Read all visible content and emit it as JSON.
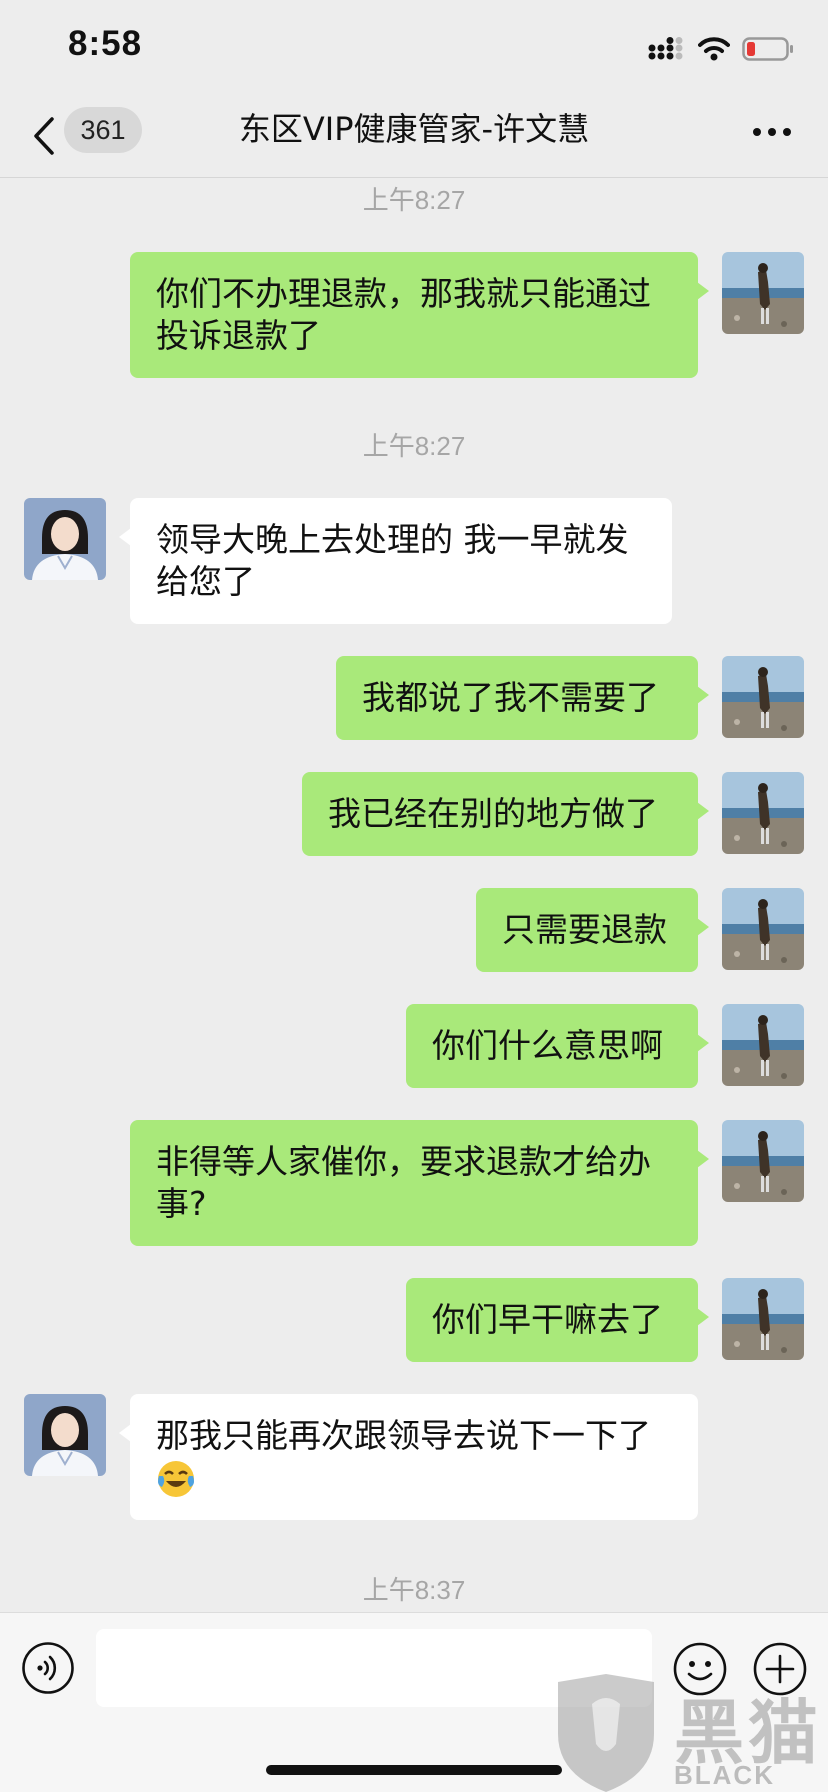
{
  "status_bar": {
    "time": "8:58"
  },
  "nav": {
    "unread_count": "361",
    "title": "东区VIP健康管家-许文慧"
  },
  "messages": [
    {
      "type": "time",
      "text": "上午8:27"
    },
    {
      "type": "outgoing",
      "text": "你们不办理退款，那我就只能通过投诉退款了"
    },
    {
      "type": "time",
      "text": "上午8:27"
    },
    {
      "type": "incoming",
      "text": "领导大晚上去处理的 我一早就发给您了"
    },
    {
      "type": "outgoing",
      "text": "我都说了我不需要了"
    },
    {
      "type": "outgoing",
      "text": "我已经在别的地方做了"
    },
    {
      "type": "outgoing",
      "text": "只需要退款"
    },
    {
      "type": "outgoing",
      "text": "你们什么意思啊"
    },
    {
      "type": "outgoing",
      "text": "非得等人家催你，要求退款才给办事?"
    },
    {
      "type": "outgoing",
      "text": "你们早干嘛去了"
    },
    {
      "type": "incoming",
      "text": "那我只能再次跟领导去说下一下了",
      "emoji": "crying-laughing-emoji"
    },
    {
      "type": "time",
      "text": "上午8:37"
    }
  ],
  "input_bar": {
    "value": ""
  },
  "watermark": {
    "main": "黑猫",
    "sub": "BLACK CAT"
  },
  "colors": {
    "outgoing_bubble": "#a9e97a",
    "incoming_bubble": "#ffffff",
    "background": "#ededed",
    "battery_low": "#e53935"
  },
  "icons": [
    "chevron-left-icon",
    "signal-icon",
    "wifi-icon",
    "battery-icon",
    "more-icon",
    "voice-icon",
    "emoji-icon",
    "plus-icon"
  ]
}
